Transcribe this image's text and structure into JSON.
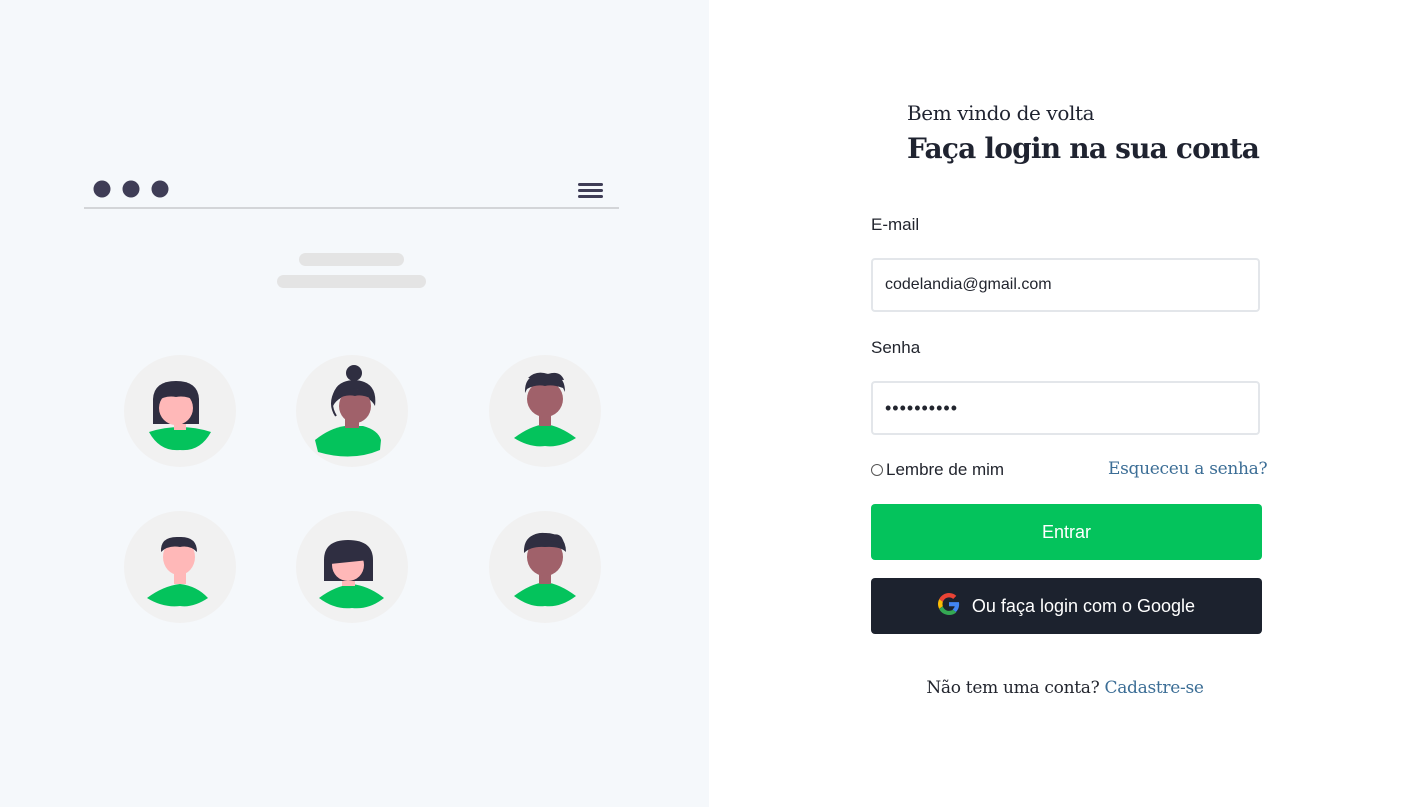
{
  "illustration": {
    "alt": "ilustração de perfis de usuários",
    "colors": {
      "skin_light": "#ffb8b8",
      "skin_dark": "#a0616a",
      "hair": "#2f2e41",
      "shirt": "#04c35c",
      "circle": "#f1f1f1",
      "window_dots": "#3f3d56"
    }
  },
  "header": {
    "welcome": "Bem vindo de volta",
    "title": "Faça login na sua conta"
  },
  "form": {
    "email_label": "E-mail",
    "email_value": "codelandia@gmail.com",
    "password_label": "Senha",
    "password_value": "••••••••••",
    "remember_label": "Lembre de mim",
    "forgot_label": "Esqueceu a senha?",
    "submit_label": "Entrar",
    "google_label": "Ou faça login com o Google"
  },
  "footer": {
    "question": "Não tem uma conta?",
    "signup_label": "Cadastre-se"
  },
  "colors": {
    "accent_green": "#04c35c",
    "dark_button": "#1c222e",
    "link_blue": "#3c6e96",
    "left_background": "#f5f8fb"
  }
}
